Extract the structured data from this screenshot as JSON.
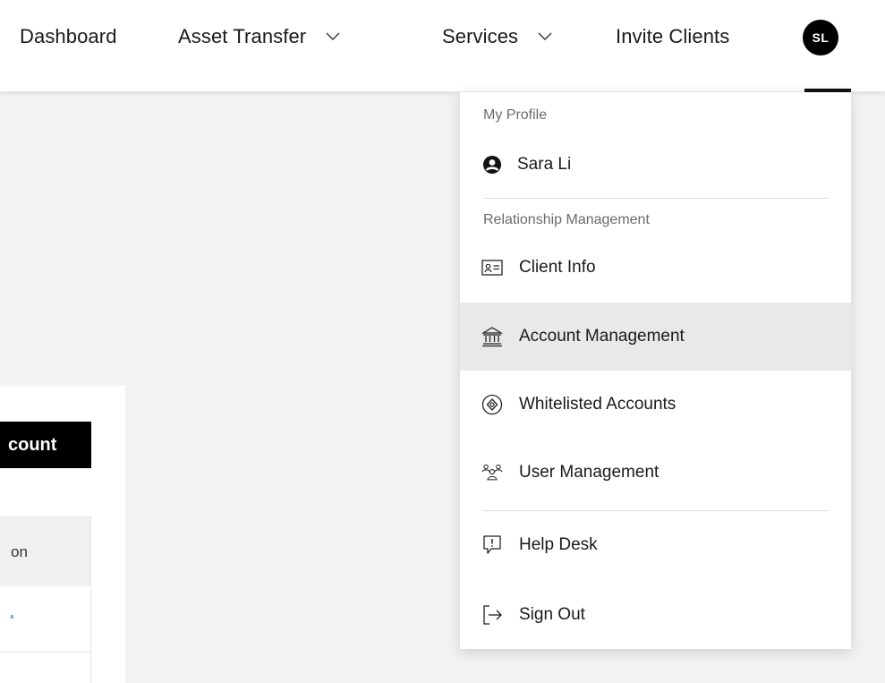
{
  "nav": {
    "dashboard": "Dashboard",
    "asset_transfer": "Asset Transfer",
    "services": "Services",
    "invite_clients": "Invite Clients",
    "avatar_initials": "SL"
  },
  "background": {
    "button_text": "count",
    "table_header_fragment": "on"
  },
  "profile_menu": {
    "my_profile_label": "My Profile",
    "user_name": "Sara Li",
    "relationship_label": "Relationship Management",
    "items": [
      {
        "label": "Client Info",
        "icon": "id-card-icon",
        "active": false
      },
      {
        "label": "Account Management",
        "icon": "bank-icon",
        "active": true
      },
      {
        "label": "Whitelisted Accounts",
        "icon": "shield-check-icon",
        "active": false
      },
      {
        "label": "User Management",
        "icon": "users-icon",
        "active": false
      },
      {
        "label": "Help Desk",
        "icon": "help-desk-icon",
        "active": false
      },
      {
        "label": "Sign Out",
        "icon": "sign-out-icon",
        "active": false
      }
    ]
  },
  "colors": {
    "active_bg": "#e9e9e9",
    "accent": "#000000",
    "link_dot": "#62b5e5"
  }
}
